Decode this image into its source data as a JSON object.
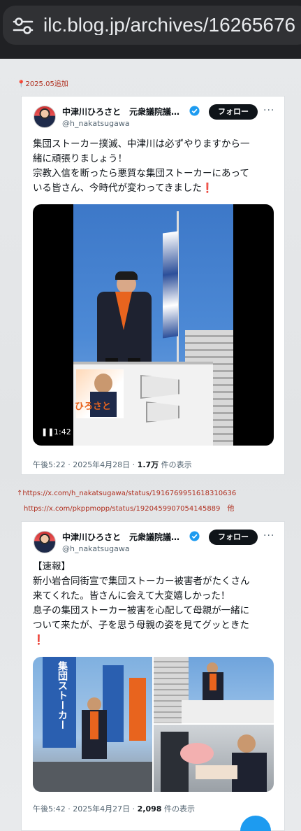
{
  "browser": {
    "url": "ilc.blog.jp/archives/16265676",
    "icon": "tune-icon"
  },
  "notes": {
    "added": "2025.05追加",
    "link1": "↑https://x.com/h_nakatsugawa/status/1916769951618310636",
    "link2": "https://x.com/pkppmopp/status/1920459907054145889　他"
  },
  "tweets": [
    {
      "name": "中津川ひろさと　元衆議院議…",
      "handle": "@h_nakatsugawa",
      "follow": "フォロー",
      "more": "···",
      "lines": [
        "集団ストーカー撲滅、中津川は必ずやりますから一",
        "緒に頑張りましょう！",
        "宗教入信を断ったら悪質な集団ストーカーにあって",
        "いる皆さん、今時代が変わってきました"
      ],
      "exclaim": "❗",
      "video_time": "1:42",
      "poster_text": "ひろさと",
      "time": "午後5:22 · 2025年4月28日 · ",
      "views": "1.7万",
      "views_suffix": " 件の表示"
    },
    {
      "name": "中津川ひろさと　元衆議院議員…",
      "handle": "@h_nakatsugawa",
      "follow": "フォロー",
      "more": "···",
      "lines": [
        "【速報】",
        "新小岩合同街宣で集団ストーカー被害者がたくさん",
        "来てくれた。皆さんに会えて大変嬉しかった！",
        "息子の集団ストーカー被害を心配して母親が一緒に",
        "ついて来たが、子を思う母親の姿を見てグッときた"
      ],
      "exclaim": "❗",
      "banner_text": "集団ストーカー",
      "time": "午後5:42 · 2025年4月27日 · ",
      "views": "2,098",
      "views_suffix": " 件の表示"
    }
  ],
  "colors": {
    "follow_bg": "#0f1419",
    "verified": "#1d9bf0",
    "note_red": "#b03020"
  }
}
